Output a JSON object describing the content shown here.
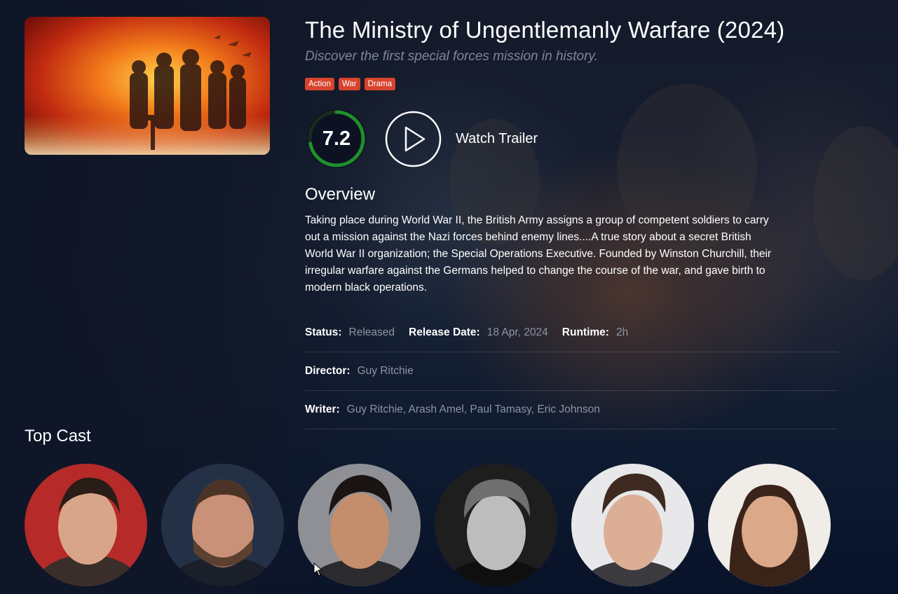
{
  "movie": {
    "title": "The Ministry of Ungentlemanly Warfare (2024)",
    "tagline": "Discover the first special forces mission in history.",
    "genres": [
      "Action",
      "War",
      "Drama"
    ],
    "rating": "7.2",
    "rating_fraction": 0.72,
    "trailer_label": "Watch Trailer"
  },
  "overview": {
    "heading": "Overview",
    "text": "Taking place during World War II, the British Army assigns a group of competent soldiers to carry out a mission against the Nazi forces behind enemy lines....A true story about a secret British World War II organization; the Special Operations Executive. Founded by Winston Churchill, their irregular warfare against the Germans helped to change the course of the war, and gave birth to modern black operations."
  },
  "details": {
    "status_label": "Status:",
    "status_value": "Released",
    "release_label": "Release Date:",
    "release_value": "18 Apr, 2024",
    "runtime_label": "Runtime:",
    "runtime_value": "2h",
    "director_label": "Director:",
    "director_value": "Guy Ritchie",
    "writer_label": "Writer:",
    "writer_value": "Guy Ritchie, Arash Amel, Paul Tamasy, Eric Johnson"
  },
  "cast": {
    "heading": "Top Cast"
  },
  "colors": {
    "genre_badge": "#d7432c",
    "rating_ring": "#1f8f2a",
    "muted_text": "#8f94a3"
  }
}
